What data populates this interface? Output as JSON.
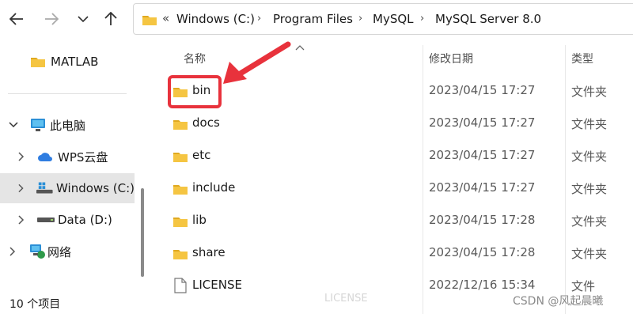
{
  "address": {
    "overflow": "«",
    "crumbs": [
      "Windows (C:)",
      "Program Files",
      "MySQL",
      "MySQL Server 8.0"
    ]
  },
  "sidebar": {
    "items": [
      {
        "label": "MATLAB",
        "icon": "folder-icon"
      },
      {
        "label": "此电脑",
        "icon": "computer-icon"
      },
      {
        "label": "WPS云盘",
        "icon": "cloud-icon"
      },
      {
        "label": "Windows (C:)",
        "icon": "windows-drive-icon"
      },
      {
        "label": "Data (D:)",
        "icon": "drive-icon"
      },
      {
        "label": "网络",
        "icon": "network-icon"
      }
    ]
  },
  "columns": {
    "name": "名称",
    "modified": "修改日期",
    "type": "类型"
  },
  "files": [
    {
      "name": "bin",
      "modified": "2023/04/15 17:27",
      "type": "文件夹",
      "icon": "folder-icon"
    },
    {
      "name": "docs",
      "modified": "2023/04/15 17:27",
      "type": "文件夹",
      "icon": "folder-icon"
    },
    {
      "name": "etc",
      "modified": "2023/04/15 17:27",
      "type": "文件夹",
      "icon": "folder-icon"
    },
    {
      "name": "include",
      "modified": "2023/04/15 17:27",
      "type": "文件夹",
      "icon": "folder-icon"
    },
    {
      "name": "lib",
      "modified": "2023/04/15 17:28",
      "type": "文件夹",
      "icon": "folder-icon"
    },
    {
      "name": "share",
      "modified": "2023/04/15 17:28",
      "type": "文件夹",
      "icon": "folder-icon"
    },
    {
      "name": "LICENSE",
      "modified": "2022/12/16 15:34",
      "type": "文件",
      "icon": "file-icon"
    }
  ],
  "status": {
    "item_count": "10 个项目"
  },
  "ghost_label": "LICENSE",
  "watermark": "CSDN @风起晨曦",
  "colors": {
    "annotation": "#e8323c",
    "folder": "#f5c542",
    "selection": "#e5e5e5"
  }
}
